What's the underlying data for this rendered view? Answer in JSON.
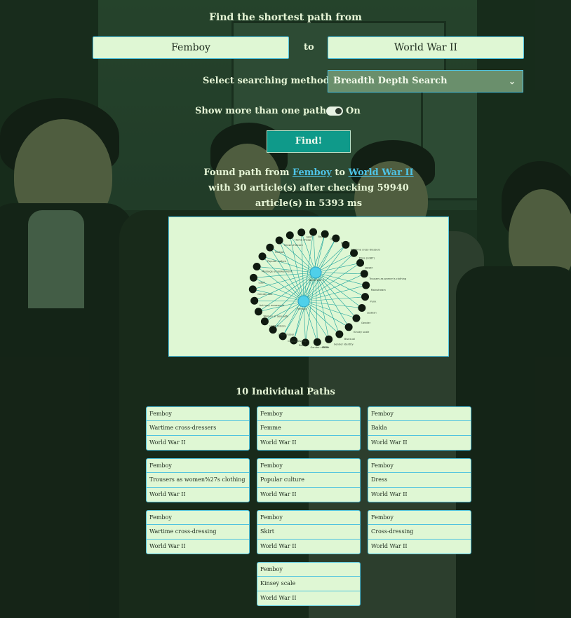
{
  "heading": "Find the shortest path from",
  "from_value": "Femboy",
  "to_label": "to",
  "to_value": "World War II",
  "method_label": "Select searching method:",
  "method_selected": "Breadth Depth Search",
  "multi_label": "Show more than one path:",
  "multi_state": "On",
  "find_label": "Find!",
  "result": {
    "prefix": "Found path from ",
    "from_link": "Femboy",
    "mid": " to ",
    "to_link": "World War II",
    "suffix": " with 30 article(s) after checking 59940 article(s) in 5393 ms"
  },
  "graph": {
    "hubs": [
      "World War II",
      "Femboy"
    ],
    "nodes": [
      "Home Sheep",
      "Skirt",
      "Bakla",
      "Queer",
      "Femme",
      "Wartime cross-dressers",
      "Pride (LGBT)",
      "BDSM",
      "Trousers as women's clothing",
      "Mainstream",
      "Punk",
      "Lesbian",
      "Gender",
      "Kinsey scale",
      "Bisexual",
      "Gender identity",
      "Batik",
      "Gender culture",
      "Dress",
      "Cross-dressing",
      "Crossdresser",
      "LGBT history",
      "Women of Sexuality",
      "Anti-gay movement",
      "Gender role",
      "LGBT",
      "Message empowerment",
      "Popular culture",
      "Fashion",
      "Drawn-Hiscock"
    ]
  },
  "paths_title": "10 Individual Paths",
  "paths": [
    [
      "Femboy",
      "Wartime cross-dressers",
      "World War II"
    ],
    [
      "Femboy",
      "Femme",
      "World War II"
    ],
    [
      "Femboy",
      "Bakla",
      "World War II"
    ],
    [
      "Femboy",
      "Trousers as women%27s clothing",
      "World War II"
    ],
    [
      "Femboy",
      "Popular culture",
      "World War II"
    ],
    [
      "Femboy",
      "Dress",
      "World War II"
    ],
    [
      "Femboy",
      "Wartime cross-dressing",
      "World War II"
    ],
    [
      "Femboy",
      "Skirt",
      "World War II"
    ],
    [
      "Femboy",
      "Cross-dressing",
      "World War II"
    ],
    [
      "Femboy",
      "Kinsey scale",
      "World War II"
    ]
  ],
  "colors": {
    "accent": "#4fc3df",
    "button": "#0f9a8a",
    "panel": "#dff7d4",
    "link": "#4ec4e8"
  }
}
